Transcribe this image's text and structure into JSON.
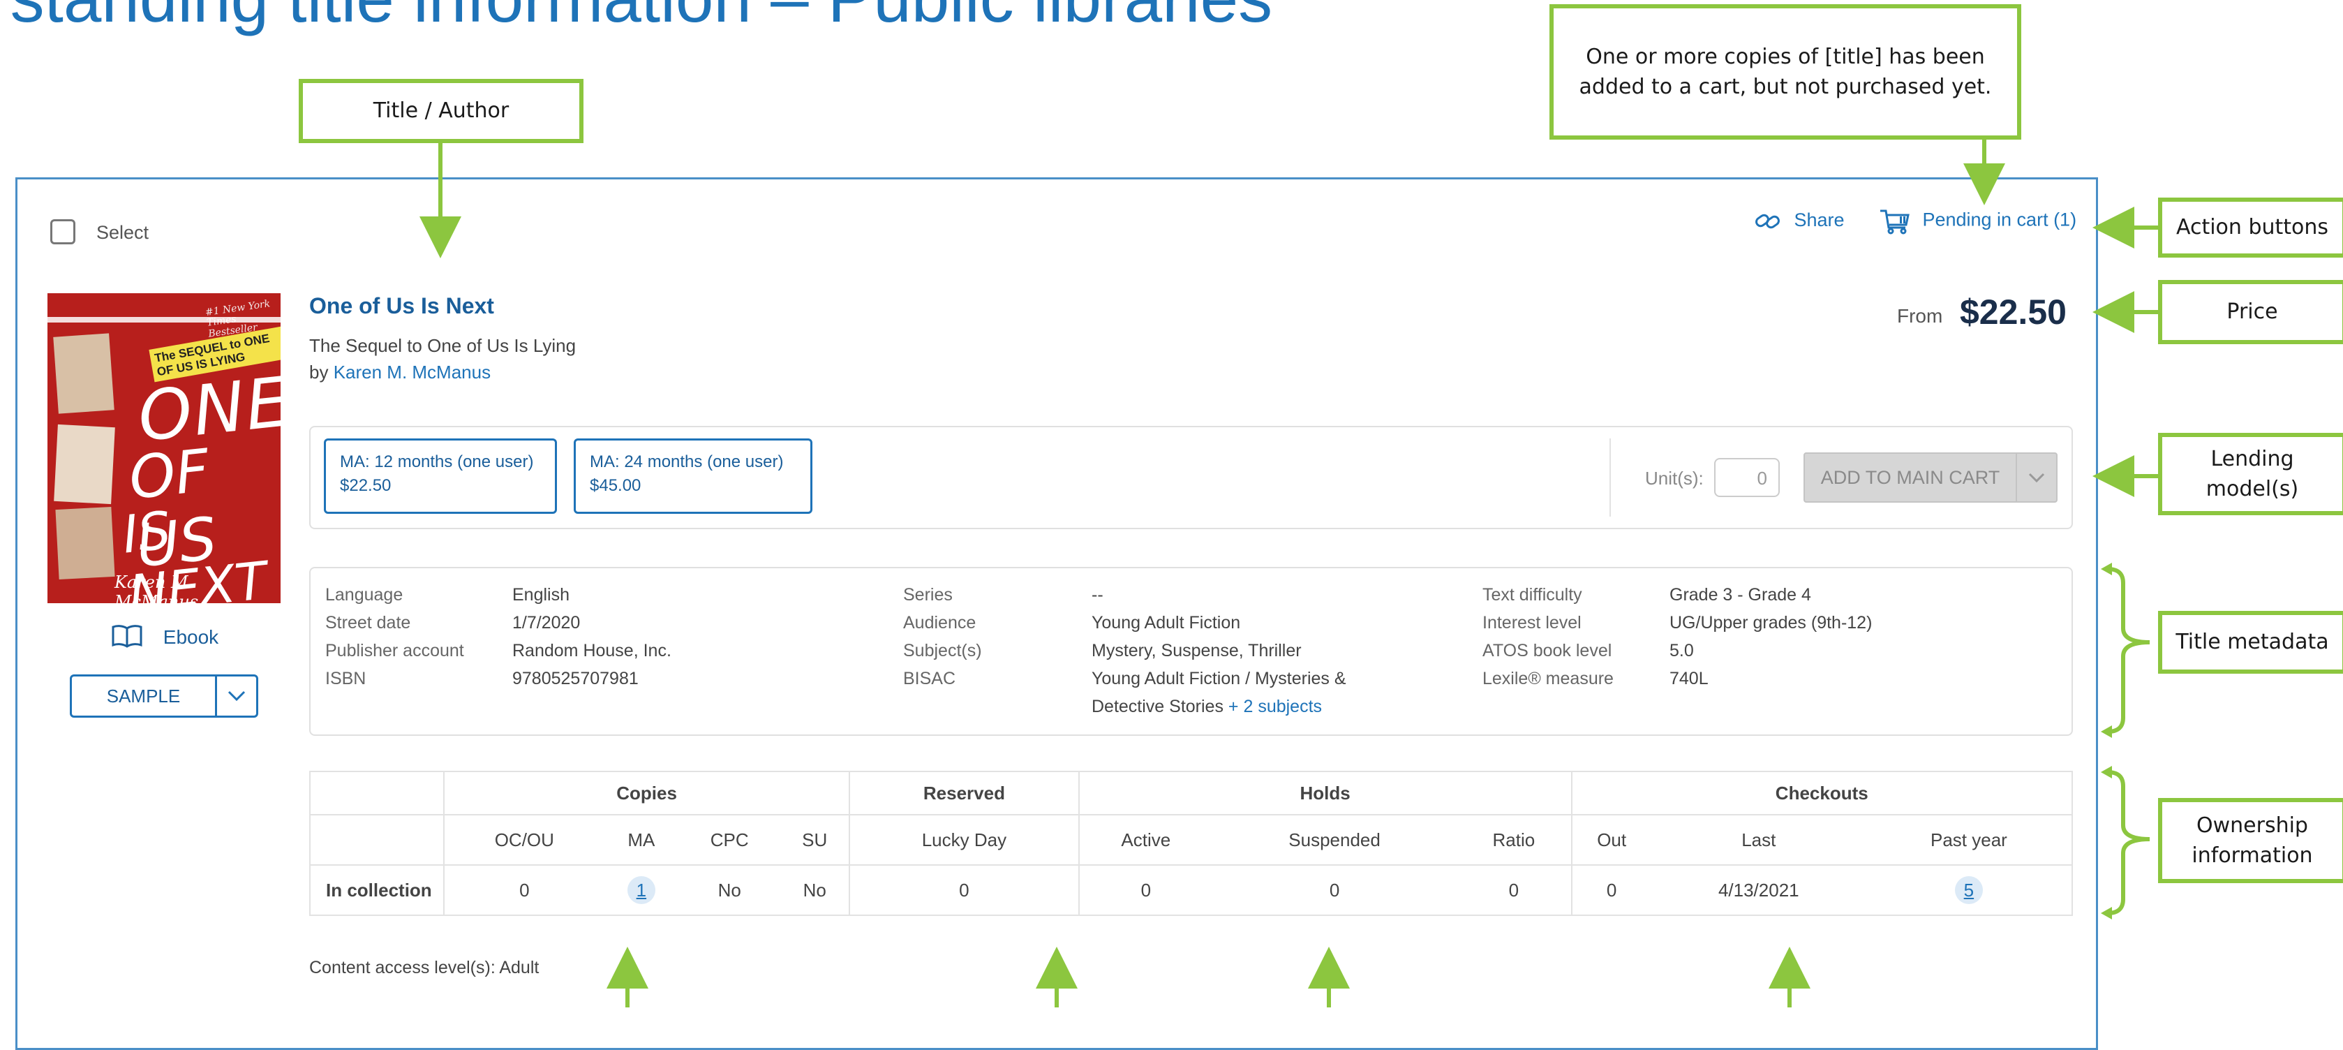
{
  "slide_title": "rstanding title information – Public libraries",
  "callouts": {
    "title_author": "Title / Author",
    "pending": "One or more copies of [title] has been added to a cart, but not purchased yet.",
    "action_buttons": "Action buttons",
    "price": "Price",
    "lending": "Lending model(s)",
    "title_metadata": "Title metadata",
    "ownership": "Ownership information"
  },
  "colors": {
    "callout_border": "#8cc63f",
    "accent": "#1e73b8",
    "slide_title": "#1e73b8"
  },
  "actions": {
    "select": "Select",
    "share": "Share",
    "pending_cart": "Pending in cart (1)"
  },
  "book": {
    "title": "One of Us Is Next",
    "subtitle": "The Sequel to One of Us Is Lying",
    "by": "by ",
    "author": "Karen M. McManus",
    "format": "Ebook",
    "sample": "SAMPLE",
    "price_prefix": "From",
    "price": "$22.50",
    "cover": {
      "banner": "#1 New York Times Bestseller",
      "tag": "The SEQUEL to ONE OF US IS LYING",
      "line1": "ONE",
      "line2": "OF US",
      "line3": "IS NEXT",
      "author": "Karen M. McManus"
    }
  },
  "lending": {
    "options": [
      {
        "term": "MA: 12 months (one user)",
        "price": "$22.50"
      },
      {
        "term": "MA: 24 months (one user)",
        "price": "$45.00"
      }
    ],
    "units_label": "Unit(s):",
    "units_value": "0",
    "add_button": "ADD TO MAIN CART"
  },
  "metadata": {
    "col1": {
      "labels": [
        "Language",
        "Street date",
        "Publisher account",
        "ISBN"
      ],
      "values": [
        "English",
        "1/7/2020",
        "Random House, Inc.",
        "9780525707981"
      ]
    },
    "col2": {
      "labels": [
        "Series",
        "Audience",
        "Subject(s)",
        "BISAC"
      ],
      "values": [
        "--",
        "Young Adult Fiction",
        "Mystery, Suspense, Thriller",
        "Young Adult Fiction / Mysteries &",
        "Detective Stories "
      ],
      "more_subjects": "+ 2 subjects"
    },
    "col3": {
      "labels": [
        "Text difficulty",
        "Interest level",
        "ATOS book level",
        "Lexile® measure"
      ],
      "values": [
        "Grade 3 - Grade 4",
        "UG/Upper grades (9th-12)",
        "5.0",
        "740L"
      ]
    }
  },
  "ownership": {
    "groups": [
      "Copies",
      "Reserved",
      "Holds",
      "Checkouts"
    ],
    "columns": [
      "OC/OU",
      "MA",
      "CPC",
      "SU",
      "Lucky Day",
      "Active",
      "Suspended",
      "Ratio",
      "Out",
      "Last",
      "Past year"
    ],
    "row_label": "In collection",
    "row": [
      "0",
      "1",
      "No",
      "No",
      "0",
      "0",
      "0",
      "0",
      "0",
      "4/13/2021",
      "5"
    ]
  },
  "content_access": "Content access level(s): Adult"
}
